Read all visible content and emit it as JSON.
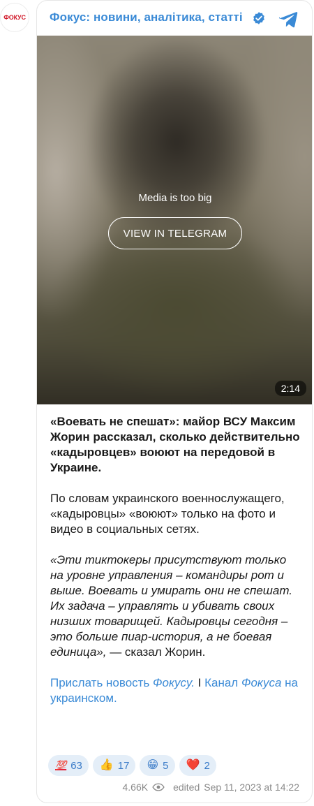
{
  "avatar": {
    "label": "ФОКУС"
  },
  "header": {
    "channel_name": "Фокус: новини, аналітика, статті",
    "verified_icon": "verified-badge-icon",
    "telegram_icon": "telegram-icon",
    "accent": "#3a8ad6"
  },
  "media": {
    "message": "Media is too big",
    "button_label": "VIEW IN TELEGRAM",
    "duration": "2:14"
  },
  "post": {
    "headline": "«Воевать не спешат»: майор ВСУ Максим Жорин рассказал, сколько действительно «кадыровцев» воюют на передовой в Украине.",
    "paragraph": "По словам украинского военнослужащего, «кадыровцы» «воюют» только на фото и видео в социальных сетях.",
    "quote": "«Эти тиктокеры присутствуют только на уровне управления – командиры рот и выше. Воевать и умирать они не спешат. Их задача – управлять и убивать своих низших товарищей. Кадыровцы сегодня – это больше пиар-история, а не боевая единица»,",
    "quote_attribution": " — сказал Жорин.",
    "link1_text": "Прислать новость ",
    "link1_italic": "Фокусу.",
    "separator": " I ",
    "link2_text": "Канал ",
    "link2_italic": "Фокуса",
    "link2_tail": " на украинском."
  },
  "reactions": [
    {
      "emoji": "💯",
      "icon": "hundred-points-icon",
      "count": "63"
    },
    {
      "emoji": "👍",
      "icon": "thumbs-up-icon",
      "count": "17"
    },
    {
      "emoji": "😁",
      "icon": "grinning-face-icon",
      "count": "5"
    },
    {
      "emoji": "❤️",
      "icon": "red-heart-icon",
      "count": "2"
    }
  ],
  "footer": {
    "views": "4.66K",
    "views_icon": "eye-icon",
    "edited_label": "edited",
    "date": "Sep 11, 2023 at 14:22"
  }
}
